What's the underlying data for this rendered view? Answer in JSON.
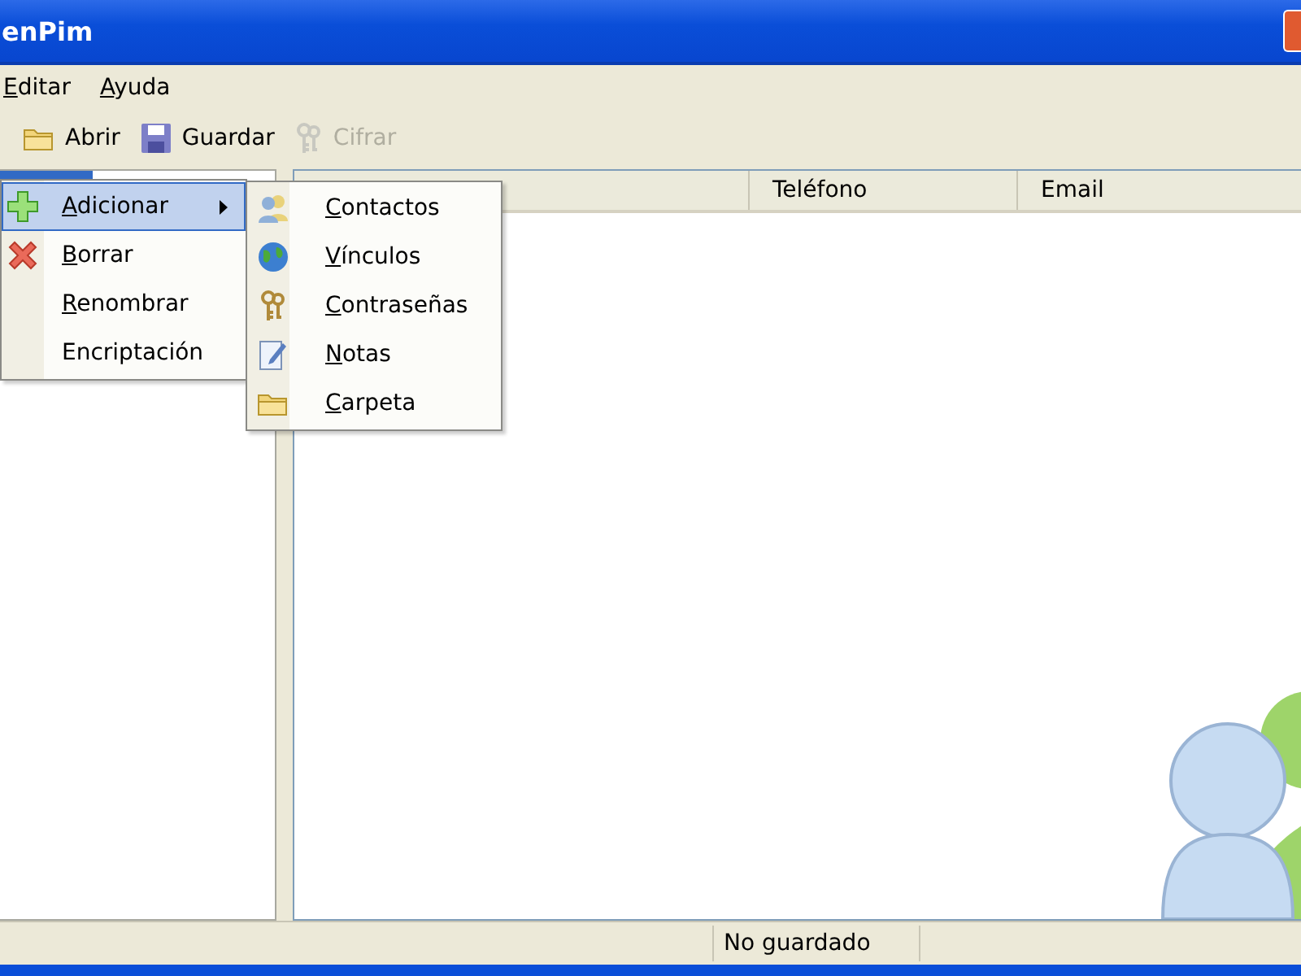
{
  "window": {
    "title": "enPim"
  },
  "menu_bar": [
    {
      "label": "Editar",
      "mnemonic": true
    },
    {
      "label": "Ayuda",
      "mnemonic": true
    }
  ],
  "toolbar": [
    {
      "label": "Abrir",
      "kind": "folder",
      "disabled": false
    },
    {
      "label": "Guardar",
      "kind": "save",
      "disabled": false
    },
    {
      "label": "Cifrar",
      "kind": "keys",
      "disabled": true
    }
  ],
  "list": {
    "columns": [
      {
        "label": "Teléfono"
      },
      {
        "label": "Email"
      }
    ]
  },
  "context_menu": {
    "items": [
      {
        "label": "Adicionar",
        "kind": "plus",
        "mnemonic": true,
        "submenu": true,
        "selected": true
      },
      {
        "label": "Borrar",
        "kind": "delete",
        "mnemonic": true,
        "submenu": false,
        "selected": false
      },
      {
        "label": "Renombrar",
        "kind": "plain",
        "mnemonic": true,
        "submenu": false,
        "selected": false
      },
      {
        "label": "Encriptación",
        "kind": "plain",
        "mnemonic": false,
        "submenu": false,
        "selected": false
      }
    ],
    "submenu": [
      {
        "label": "Contactos",
        "kind": "people",
        "mnemonic": true,
        "selected": false
      },
      {
        "label": "Vínculos",
        "kind": "globe",
        "mnemonic": true,
        "selected": false
      },
      {
        "label": "Contraseñas",
        "kind": "keys",
        "mnemonic": true,
        "selected": false
      },
      {
        "label": "Notas",
        "kind": "note",
        "mnemonic": true,
        "selected": false
      },
      {
        "label": "Carpeta",
        "kind": "folder",
        "mnemonic": true,
        "selected": false
      }
    ]
  },
  "status_bar": [
    {
      "text": "No guardado"
    }
  ]
}
